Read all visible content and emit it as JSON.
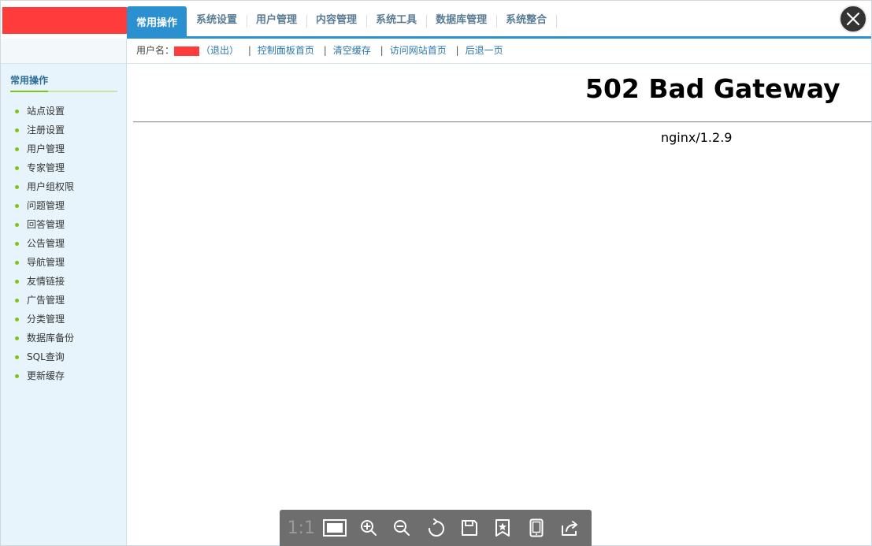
{
  "header": {
    "tabs": [
      {
        "label": "常用操作",
        "active": true
      },
      {
        "label": "系统设置",
        "active": false
      },
      {
        "label": "用户管理",
        "active": false
      },
      {
        "label": "内容管理",
        "active": false
      },
      {
        "label": "系统工具",
        "active": false
      },
      {
        "label": "数据库管理",
        "active": false
      },
      {
        "label": "系统整合",
        "active": false
      }
    ]
  },
  "userbar": {
    "username_label": "用户名：",
    "logout": "（退出）",
    "links": [
      "控制面板首页",
      "清空缓存",
      "访问网站首页",
      "后退一页"
    ],
    "separator": "|"
  },
  "sidebar": {
    "title": "常用操作",
    "items": [
      "站点设置",
      "注册设置",
      "用户管理",
      "专家管理",
      "用户组权限",
      "问题管理",
      "回答管理",
      "公告管理",
      "导航管理",
      "友情链接",
      "广告管理",
      "分类管理",
      "数据库备份",
      "SQL查询",
      "更新缓存"
    ]
  },
  "content": {
    "error_title": "502 Bad Gateway",
    "server": "nginx/1.2.9"
  },
  "viewer_toolbar": {
    "actual_size_label": "1:1",
    "buttons": [
      "actual-size",
      "fit-window",
      "zoom-in",
      "zoom-out",
      "rotate",
      "save",
      "bookmark",
      "device",
      "share"
    ]
  },
  "colors": {
    "accent": "#2a90d0",
    "sidebar_bg": "#e8f4fb",
    "menu_dot": "#7cc41b",
    "redaction": "#ff3b3b",
    "link": "#2c77a8"
  }
}
